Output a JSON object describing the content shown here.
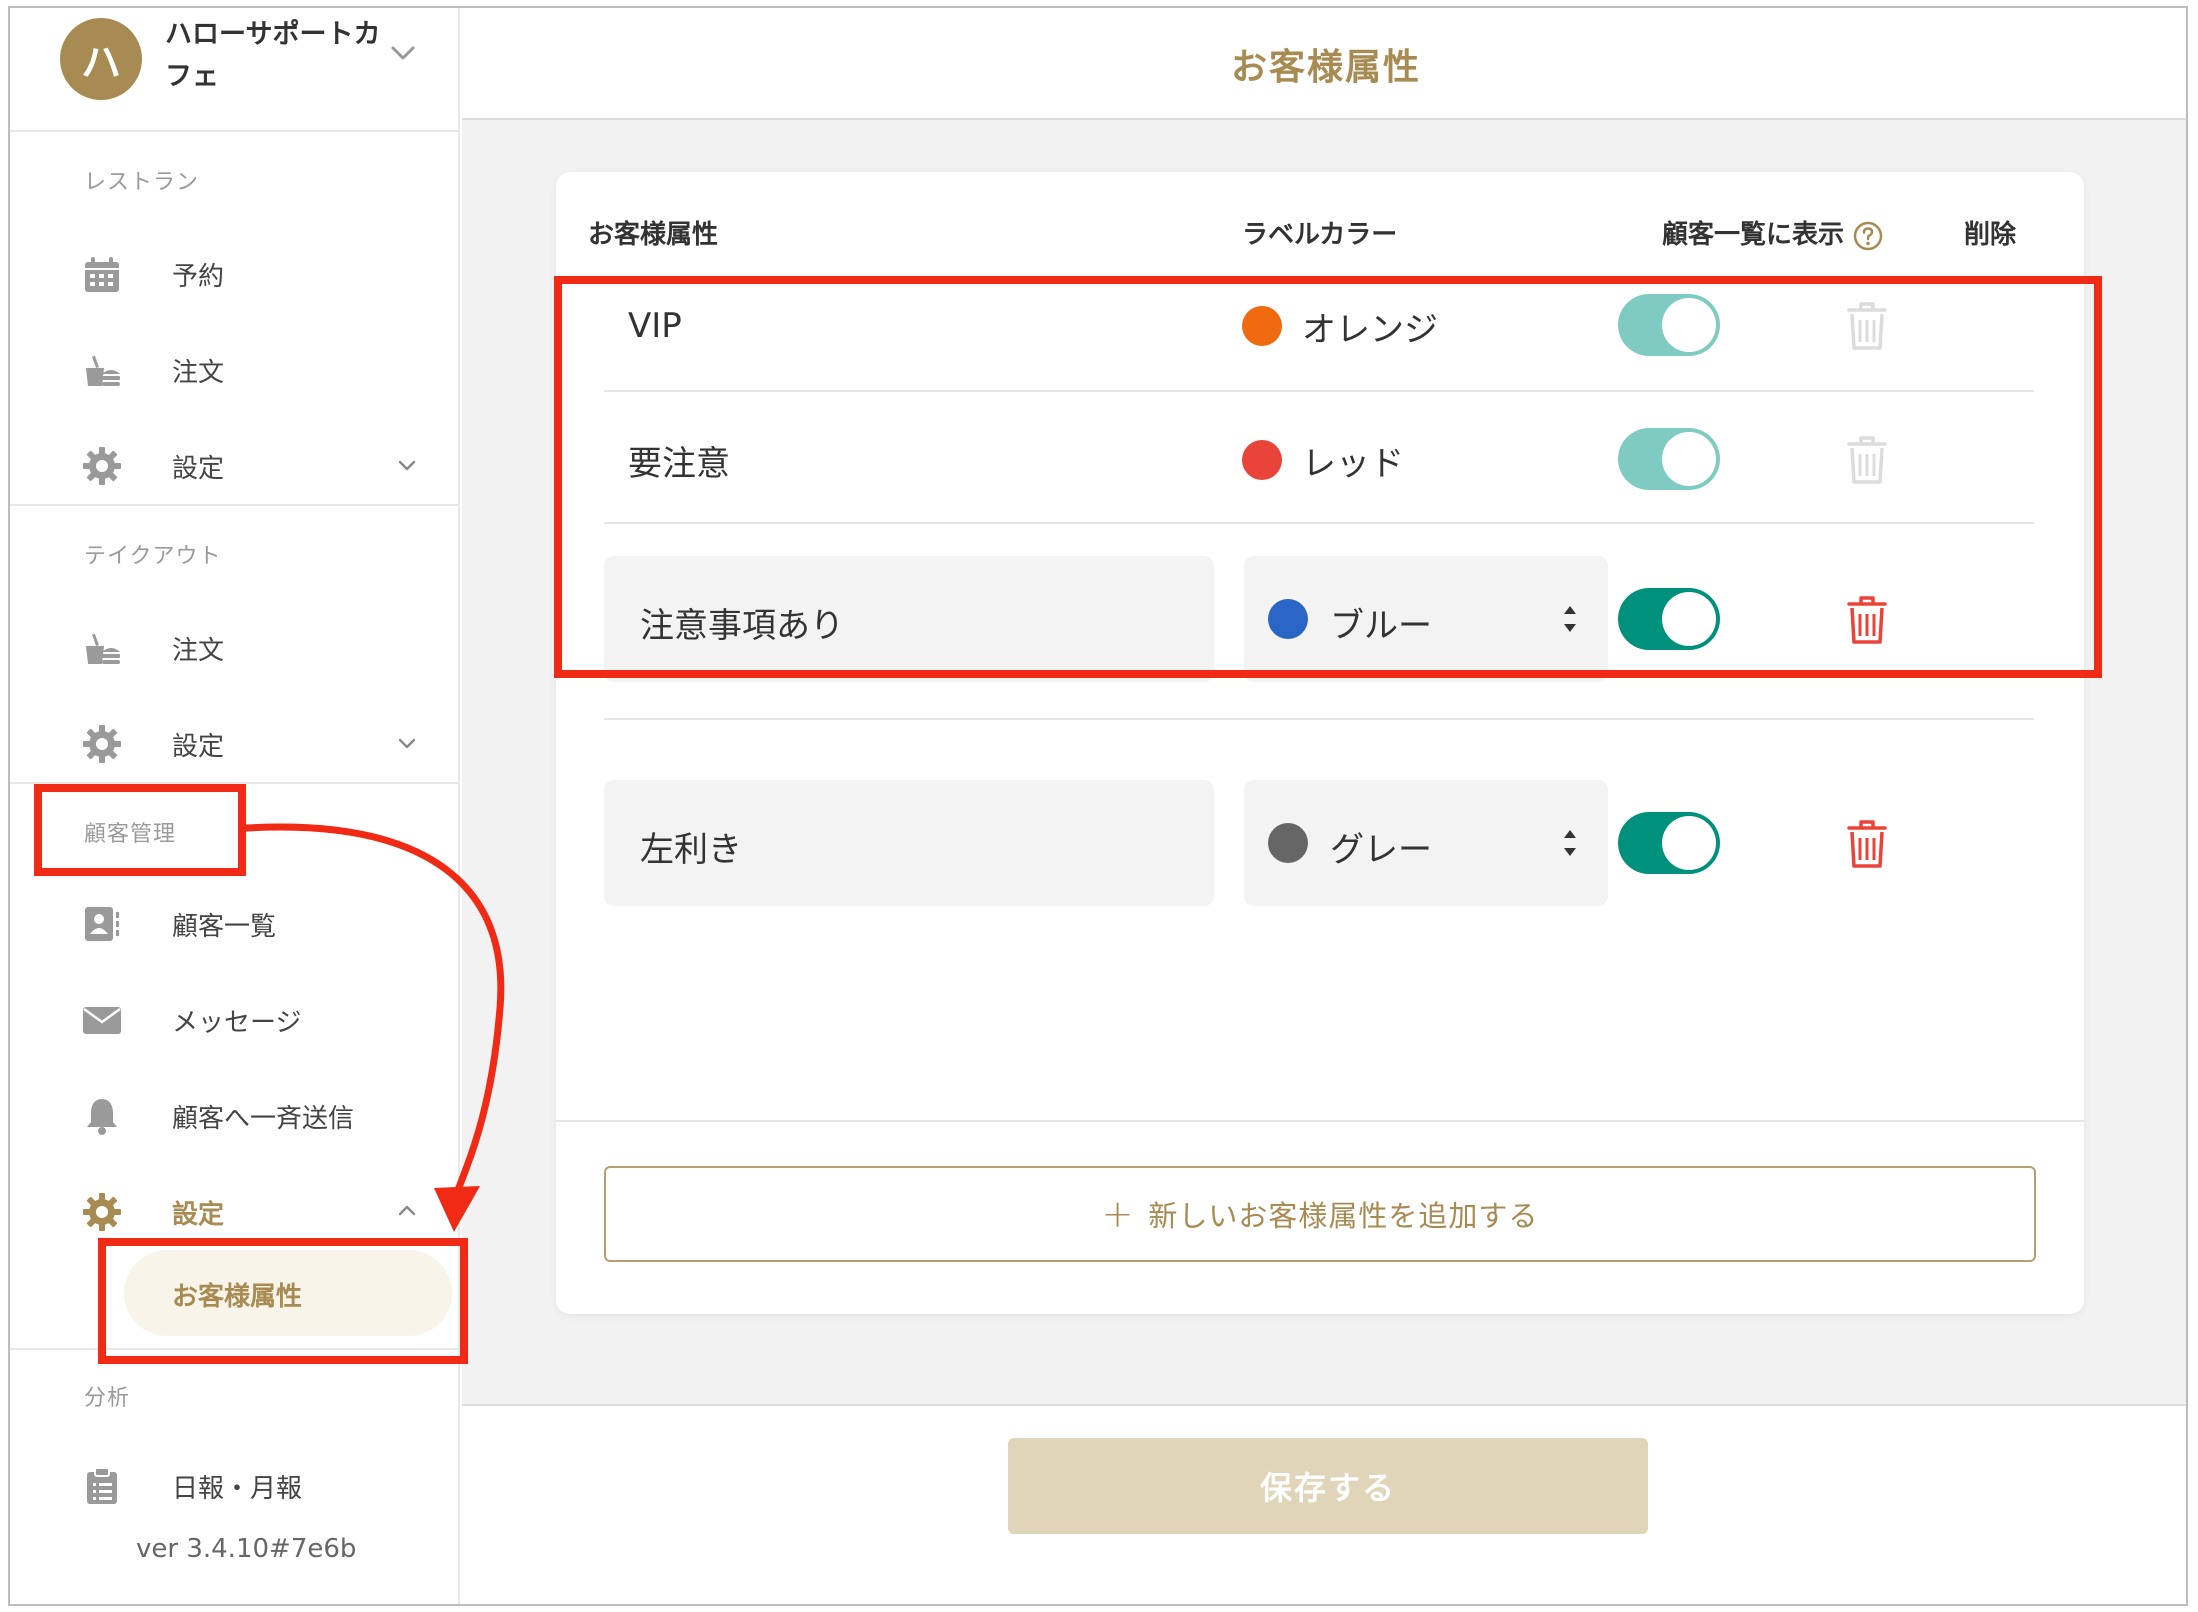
{
  "brand": {
    "avatar_initial": "ハ",
    "name": "ハローサポートカフェ"
  },
  "sidebar": {
    "sections": [
      {
        "label": "レストラン",
        "items": [
          {
            "label": "予約",
            "icon": "calendar-icon"
          },
          {
            "label": "注文",
            "icon": "food-icon"
          },
          {
            "label": "設定",
            "icon": "gear-icon"
          }
        ]
      },
      {
        "label": "テイクアウト",
        "items": [
          {
            "label": "注文",
            "icon": "food-icon"
          },
          {
            "label": "設定",
            "icon": "gear-icon"
          }
        ]
      },
      {
        "label": "顧客管理",
        "items": [
          {
            "label": "顧客一覧",
            "icon": "contact-icon"
          },
          {
            "label": "メッセージ",
            "icon": "envelope-icon"
          },
          {
            "label": "顧客へ一斉送信",
            "icon": "bell-icon"
          },
          {
            "label": "設定",
            "icon": "gear-icon"
          }
        ],
        "sub_item": "お客様属性"
      },
      {
        "label": "分析",
        "items": [
          {
            "label": "日報・月報",
            "icon": "clipboard-icon"
          }
        ]
      }
    ],
    "version": "ver 3.4.10#7e6b"
  },
  "main": {
    "title": "お客様属性",
    "columns": {
      "attr": "お客様属性",
      "color": "ラベルカラー",
      "show": "顧客一覧に表示",
      "delete": "削除"
    },
    "rows": [
      {
        "name": "VIP",
        "color_label": "オレンジ",
        "color": "#f06a0f",
        "show_in_list": true,
        "editable": false
      },
      {
        "name": "要注意",
        "color_label": "レッド",
        "color": "#e8443a",
        "show_in_list": true,
        "editable": false
      },
      {
        "name": "注意事項あり",
        "color_label": "ブルー",
        "color": "#2a66c6",
        "show_in_list": true,
        "editable": true
      },
      {
        "name": "左利き",
        "color_label": "グレー",
        "color": "#666666",
        "show_in_list": true,
        "editable": true
      }
    ],
    "add_label": "新しいお客様属性を追加する",
    "save_label": "保存する"
  },
  "colors": {
    "accent": "#a88b52",
    "toggle_on": "#00917c",
    "toggle_locked": "#7fcbc2",
    "delete": "#e8443a",
    "annotation": "#f02a14"
  }
}
